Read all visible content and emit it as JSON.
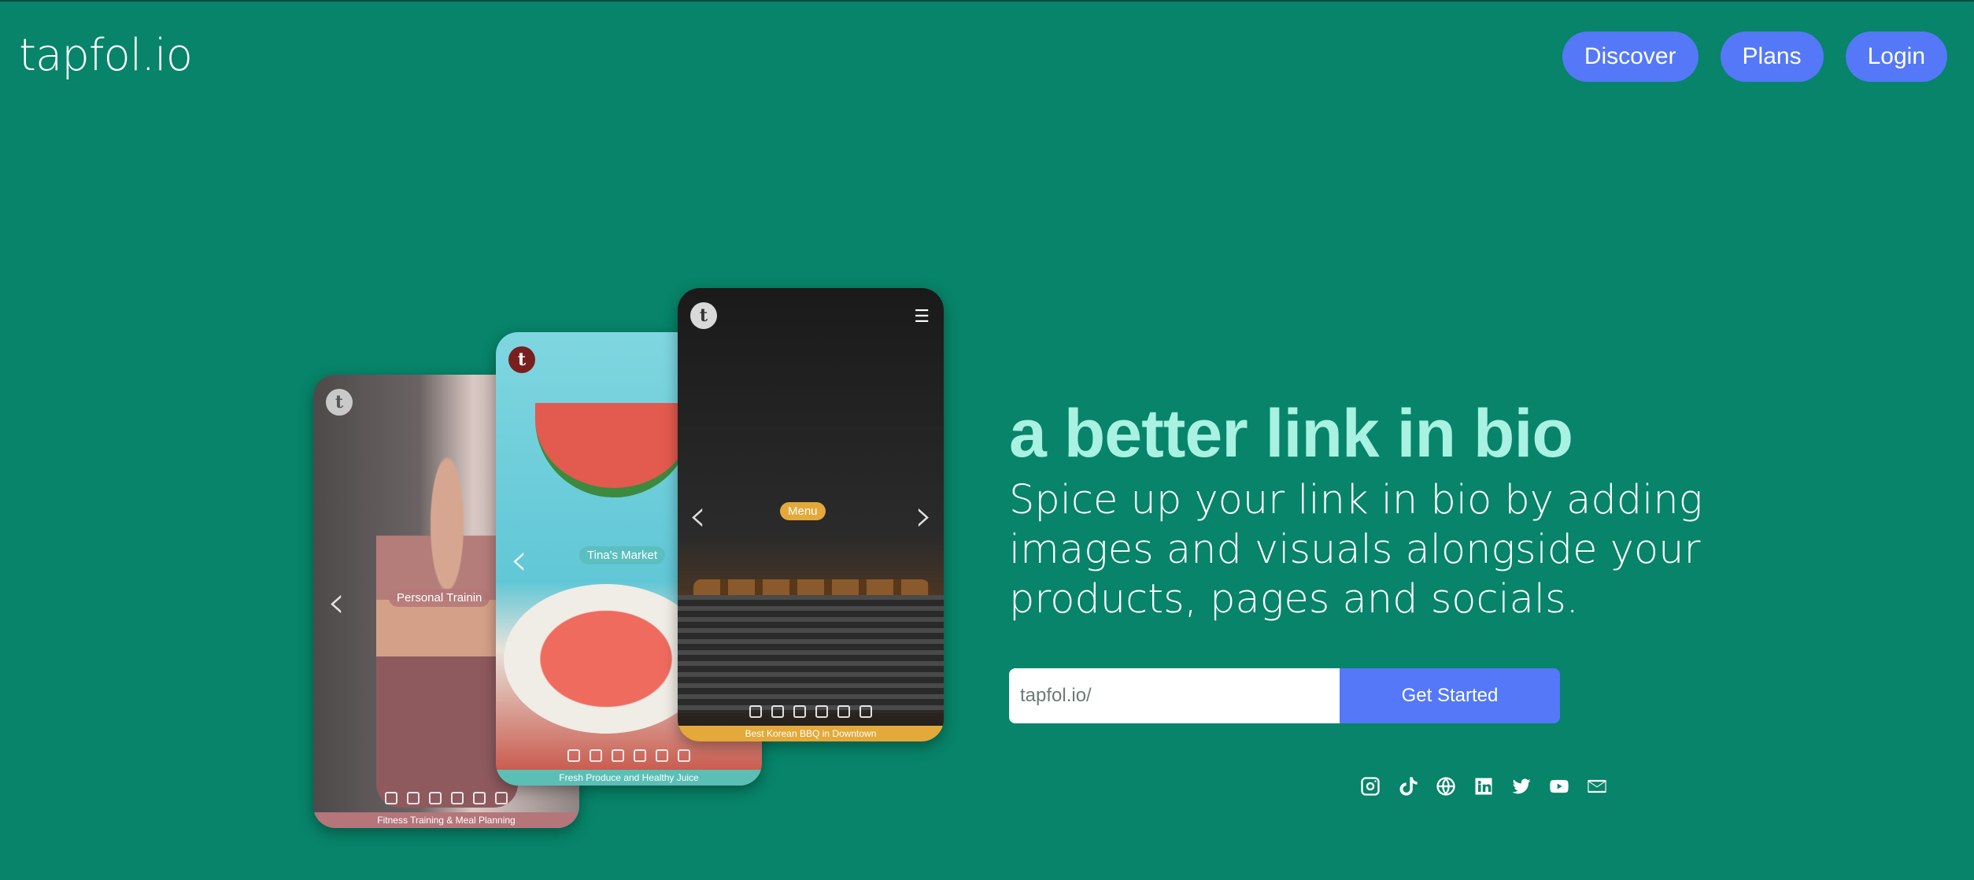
{
  "header": {
    "logo": "tapfol.io",
    "nav": [
      "Discover",
      "Plans",
      "Login"
    ]
  },
  "hero": {
    "title": "a better link in bio",
    "subtitle": "Spice up your link in bio by adding images and visuals alongside your products, pages and socials.",
    "input_value": "tapfol.io/",
    "cta": "Get Started"
  },
  "socials": [
    "instagram-icon",
    "tiktok-icon",
    "globe-icon",
    "linkedin-icon",
    "twitter-icon",
    "youtube-icon",
    "mail-icon"
  ],
  "phones": [
    {
      "badge": "t",
      "pill": "Personal Trainin",
      "footer": "Fitness Training & Meal Planning"
    },
    {
      "badge": "t",
      "pill": "Tina's Market",
      "footer": "Fresh Produce and Healthy Juice"
    },
    {
      "badge": "t",
      "pill": "Menu",
      "footer": "Best Korean BBQ in Downtown"
    }
  ],
  "colors": {
    "background": "#078469",
    "accent": "#5478f7",
    "title": "#a9f1e2"
  }
}
